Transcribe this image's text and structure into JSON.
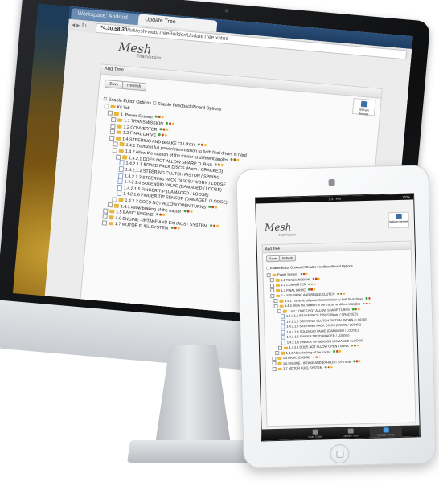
{
  "browser": {
    "tabs": [
      "Workspace: Android",
      "Update Tree"
    ],
    "url_host": "74.30.58.30",
    "url_path": "/b/Mesh-web/TreeBuilder/UpdateTree.xhtml"
  },
  "app": {
    "logo": "Mesh",
    "subtitle": "Trial Version",
    "panel_title": "Add Tree",
    "buttons": {
      "save": "Save",
      "refresh": "Refresh"
    },
    "user_box_label": "William Bennet",
    "options": {
      "enable_editor": "Enable Editor Options",
      "enable_feedback": "Enable Feedback/Board Options"
    }
  },
  "tree": [
    {
      "label": "Kit Tab",
      "depth": 0,
      "kind": "folder",
      "dots": []
    },
    {
      "label": "1. Power System",
      "depth": 1,
      "kind": "folder",
      "dots": [
        "g",
        "r",
        "y"
      ]
    },
    {
      "label": "1.1 TRANSMISSION",
      "depth": 2,
      "kind": "folder",
      "dots": [
        "g",
        "r",
        "y"
      ]
    },
    {
      "label": "1.2 CONVERTER",
      "depth": 2,
      "kind": "folder",
      "dots": [
        "g",
        "r",
        "y"
      ]
    },
    {
      "label": "1.3 FINAL DRIVE",
      "depth": 2,
      "kind": "folder",
      "dots": [
        "g",
        "r",
        "y"
      ]
    },
    {
      "label": "1.4 STEERING AND BRAKE CLUTCH",
      "depth": 2,
      "kind": "folder",
      "dots": [
        "g",
        "r",
        "y"
      ]
    },
    {
      "label": "1.4.1 Transmit full power/transmission to both final drives is hard",
      "depth": 3,
      "kind": "folder",
      "dots": []
    },
    {
      "label": "1.4.2 Allow the rotation of the tractor at different angles",
      "depth": 3,
      "kind": "folder",
      "dots": [
        "g",
        "r",
        "y"
      ]
    },
    {
      "label": "1.4.2.1 DOES NOT ALLOW SHARP TURNS",
      "depth": 4,
      "kind": "folder",
      "dots": [
        "g",
        "r",
        "y"
      ]
    },
    {
      "label": "1.4.2.1.1 BRAKE PACK DISCS (Worn / CRACKED)",
      "depth": 5,
      "kind": "page",
      "dots": []
    },
    {
      "label": "1.4.2.1.2 STEERING CLUTCH PISTON / SPRING",
      "depth": 5,
      "kind": "page",
      "dots": []
    },
    {
      "label": "1.4.2.1.3 STEERING PACK DISCS / WORN / LOOSE",
      "depth": 5,
      "kind": "page",
      "dots": []
    },
    {
      "label": "1.4.2.1.4 SOLENOID VALVE (DAMAGED / LOOSE)",
      "depth": 5,
      "kind": "page",
      "dots": []
    },
    {
      "label": "1.4.2.1.5 FINGER TIP (DAMAGED / LOOSE)",
      "depth": 5,
      "kind": "page",
      "dots": []
    },
    {
      "label": "1.4.2.1.6 FINGER TIP SENSOR (DAMAGED / LOOSE)",
      "depth": 5,
      "kind": "page",
      "dots": []
    },
    {
      "label": "1.4.2.2 DOES NOT ALLOW OPEN TURNS",
      "depth": 4,
      "kind": "folder",
      "dots": [
        "g",
        "r",
        "y"
      ]
    },
    {
      "label": "1.4.3 Allow braking of the tractor",
      "depth": 3,
      "kind": "folder",
      "dots": [
        "g",
        "r",
        "y"
      ]
    },
    {
      "label": "1.5 BASIC ENGINE",
      "depth": 2,
      "kind": "folder",
      "dots": [
        "g",
        "r",
        "y"
      ]
    },
    {
      "label": "1.6 ENGINE - INTAKE AND EXHAUST SYSTEM",
      "depth": 2,
      "kind": "folder",
      "dots": [
        "g",
        "r",
        "y"
      ]
    },
    {
      "label": "1.7 MOTOR FUEL SYSTEM",
      "depth": 2,
      "kind": "folder",
      "dots": [
        "g",
        "r",
        "y"
      ]
    }
  ],
  "ipad": {
    "status_center": "1:37 PM",
    "status_right": "100%",
    "tree": [
      {
        "label": "Power System",
        "depth": 0,
        "kind": "folder",
        "dots": [
          "g",
          "r",
          "y"
        ]
      },
      {
        "label": "1.1 TRANSMISSION",
        "depth": 1,
        "kind": "folder",
        "dots": [
          "g",
          "r",
          "y"
        ]
      },
      {
        "label": "1.2 CONVERTER",
        "depth": 1,
        "kind": "folder",
        "dots": [
          "g",
          "r",
          "y"
        ]
      },
      {
        "label": "1.3 FINAL DRIVE",
        "depth": 1,
        "kind": "folder",
        "dots": [
          "g",
          "r",
          "y"
        ]
      },
      {
        "label": "1.4 STEERING AND BRAKE CLUTCH",
        "depth": 1,
        "kind": "folder",
        "dots": [
          "g",
          "r",
          "y"
        ]
      },
      {
        "label": "1.4.1 Transmit full power/transmission to both final drives",
        "depth": 2,
        "kind": "folder",
        "dots": [
          "g",
          "r"
        ]
      },
      {
        "label": "1.4.2 Allow the rotation of the tractor at different angles",
        "depth": 2,
        "kind": "folder",
        "dots": [
          "g",
          "r",
          "y"
        ]
      },
      {
        "label": "1.4.2.1 DOES NOT ALLOW SHARP TURNS",
        "depth": 3,
        "kind": "folder",
        "dots": [
          "g",
          "r",
          "y"
        ]
      },
      {
        "label": "1.4.2.1.1 BRAKE PACK DISCS (Worn / CRACKED)",
        "depth": 4,
        "kind": "page",
        "dots": []
      },
      {
        "label": "1.4.2.1.2 STEERING CLUTCH PISTON (WORN / LOOSE)",
        "depth": 4,
        "kind": "page",
        "dots": []
      },
      {
        "label": "1.4.2.1.3 STEERING PACK DISCS (WORN / LOOSE)",
        "depth": 4,
        "kind": "page",
        "dots": []
      },
      {
        "label": "1.4.2.1.4 SOLENOID VALVE (DAMAGED / LOOSE)",
        "depth": 4,
        "kind": "page",
        "dots": []
      },
      {
        "label": "1.4.2.1.5 FINGER TIP (DAMAGED / LOOSE)",
        "depth": 4,
        "kind": "page",
        "dots": []
      },
      {
        "label": "1.4.2.1.6 FINGER TIP SENSOR (DAMAGED / LOOSE)",
        "depth": 4,
        "kind": "page",
        "dots": []
      },
      {
        "label": "1.4.2.2 DOES NOT ALLOW OPEN TURNS",
        "depth": 3,
        "kind": "folder",
        "dots": [
          "g",
          "r",
          "y"
        ]
      },
      {
        "label": "1.4.3 Allow braking of the tractor",
        "depth": 2,
        "kind": "folder",
        "dots": [
          "g",
          "r",
          "y"
        ]
      },
      {
        "label": "1.5 BASIC ENGINE",
        "depth": 1,
        "kind": "folder",
        "dots": [
          "g",
          "r",
          "y"
        ]
      },
      {
        "label": "1.6 ENGINE - INTAKE AND EXHAUST SYSTEM",
        "depth": 1,
        "kind": "folder",
        "dots": [
          "g",
          "r",
          "y"
        ]
      },
      {
        "label": "1.7 MOTOR FUEL SYSTEM",
        "depth": 1,
        "kind": "folder",
        "dots": [
          "g",
          "r",
          "y"
        ]
      }
    ],
    "tabs": [
      {
        "label": "Load Case",
        "active": false
      },
      {
        "label": "Update Tree",
        "active": false
      },
      {
        "label": "Update Trees",
        "active": true
      }
    ]
  },
  "colors": {
    "status_green": "#3aa83a",
    "status_red": "#d23a2a",
    "status_yellow": "#e8c12a",
    "folder": "#e8b73a",
    "accent_blue": "#3d6ea8"
  }
}
